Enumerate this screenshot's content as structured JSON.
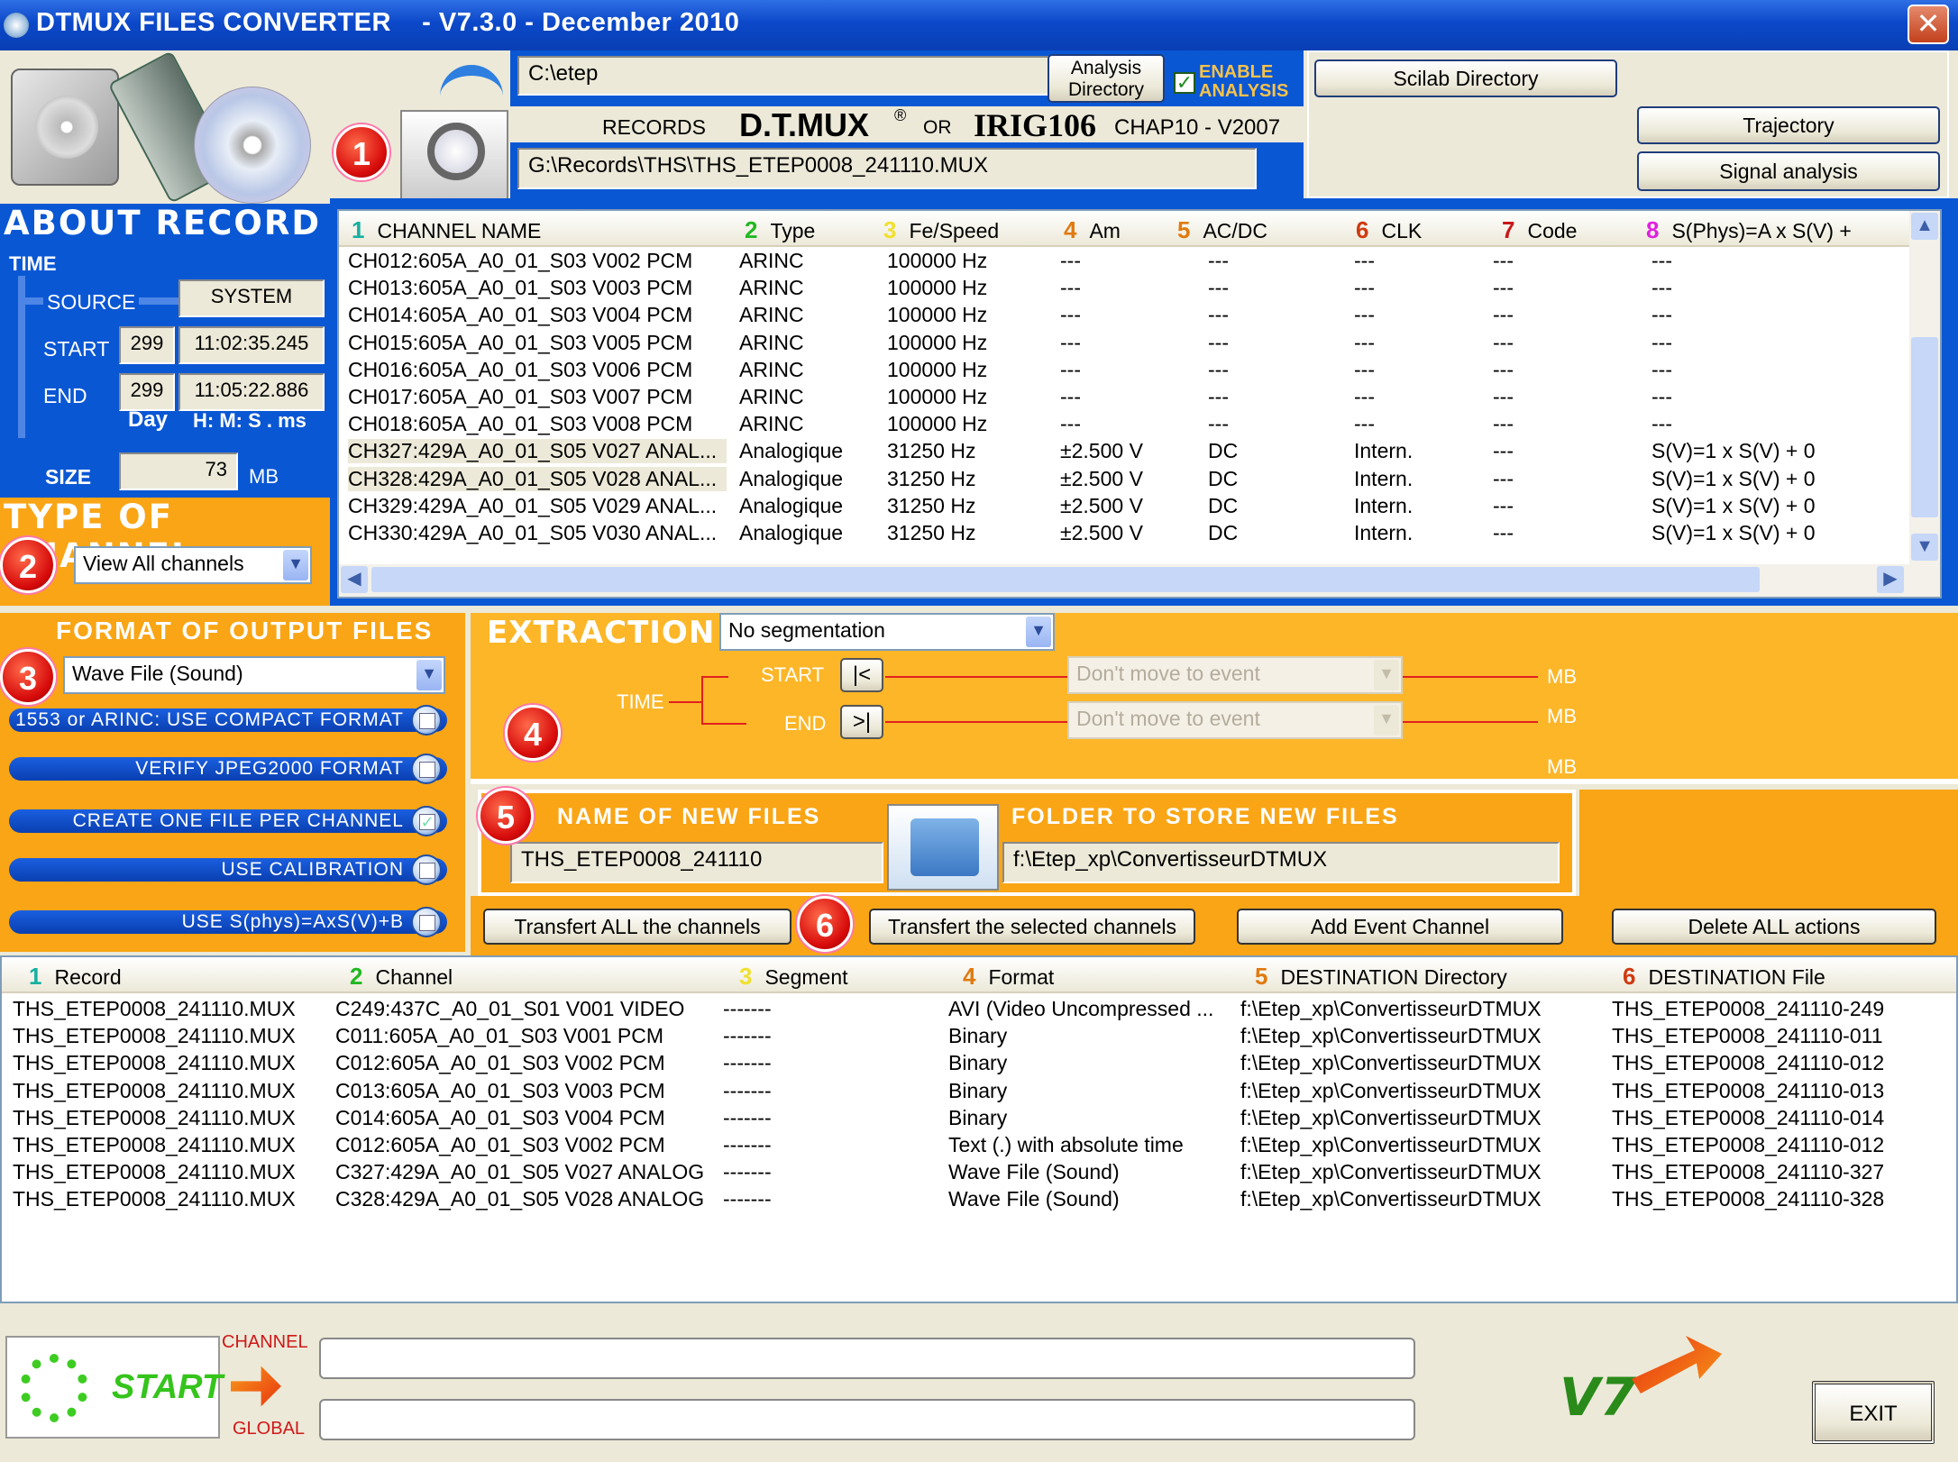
{
  "window": {
    "title": "DTMUX FILES CONVERTER    - V7.3.0 - December 2010"
  },
  "top": {
    "analysis_path": "C:\\etep",
    "analysis_dir_label": "Analysis Directory",
    "enable_analysis": "ENABLE ANALYSIS",
    "records_label": "RECORDS",
    "dtmux_label": "D.T.MUX",
    "reg_mark": "®",
    "or_label": "OR",
    "irig_label": "IRIG106",
    "chap_label": "CHAP10 - V2007",
    "record_path": "G:\\Records\\THS\\THS_ETEP0008_241110.MUX",
    "scilab_btn": "Scilab Directory",
    "trajectory_btn": "Trajectory",
    "signal_btn": "Signal analysis"
  },
  "about": {
    "title": "ABOUT  RECORD",
    "time_label": "TIME",
    "source_label": "SOURCE",
    "source_value": "SYSTEM",
    "start_label": "START",
    "start_day": "299",
    "start_time": "11:02:35.245",
    "end_label": "END",
    "end_day": "299",
    "end_time": "11:05:22.886",
    "day_label": "Day",
    "hms_label": "H: M: S . ms",
    "size_label": "SIZE",
    "size_value": "73",
    "size_unit": "MB"
  },
  "type_of_channel": {
    "title": "TYPE  OF  CHANNEL",
    "selected": "View All channels"
  },
  "badges": {
    "b1": "1",
    "b2": "2",
    "b3": "3",
    "b4": "4",
    "b5": "5",
    "b6": "6"
  },
  "channel_table": {
    "headers": [
      {
        "n": "1",
        "label": "CHANNEL NAME",
        "color": "#17b0a0"
      },
      {
        "n": "2",
        "label": "Type",
        "color": "#22b822"
      },
      {
        "n": "3",
        "label": "Fe/Speed",
        "color": "#f0e030"
      },
      {
        "n": "4",
        "label": "Am",
        "color": "#e07a10"
      },
      {
        "n": "5",
        "label": "AC/DC",
        "color": "#e07a10"
      },
      {
        "n": "6",
        "label": "CLK",
        "color": "#d03a10"
      },
      {
        "n": "7",
        "label": "Code",
        "color": "#c81818"
      },
      {
        "n": "8",
        "label": "S(Phys)=A x S(V) +",
        "color": "#e020e0"
      }
    ],
    "rows": [
      [
        "CH012:605A_A0_01_S03 V002 PCM",
        "ARINC",
        "100000 Hz",
        "---",
        "---",
        "---",
        "---",
        "---"
      ],
      [
        "CH013:605A_A0_01_S03 V003 PCM",
        "ARINC",
        "100000 Hz",
        "---",
        "---",
        "---",
        "---",
        "---"
      ],
      [
        "CH014:605A_A0_01_S03 V004 PCM",
        "ARINC",
        "100000 Hz",
        "---",
        "---",
        "---",
        "---",
        "---"
      ],
      [
        "CH015:605A_A0_01_S03 V005 PCM",
        "ARINC",
        "100000 Hz",
        "---",
        "---",
        "---",
        "---",
        "---"
      ],
      [
        "CH016:605A_A0_01_S03 V006 PCM",
        "ARINC",
        "100000 Hz",
        "---",
        "---",
        "---",
        "---",
        "---"
      ],
      [
        "CH017:605A_A0_01_S03 V007 PCM",
        "ARINC",
        "100000 Hz",
        "---",
        "---",
        "---",
        "---",
        "---"
      ],
      [
        "CH018:605A_A0_01_S03 V008 PCM",
        "ARINC",
        "100000 Hz",
        "---",
        "---",
        "---",
        "---",
        "---"
      ],
      [
        "CH327:429A_A0_01_S05 V027 ANAL...",
        "Analogique",
        "31250 Hz",
        "±2.500 V",
        "DC",
        "Intern.",
        "---",
        "S(V)=1 x S(V) + 0"
      ],
      [
        "CH328:429A_A0_01_S05 V028 ANAL...",
        "Analogique",
        "31250 Hz",
        "±2.500 V",
        "DC",
        "Intern.",
        "---",
        "S(V)=1 x S(V) + 0"
      ],
      [
        "CH329:429A_A0_01_S05 V029 ANAL...",
        "Analogique",
        "31250 Hz",
        "±2.500 V",
        "DC",
        "Intern.",
        "---",
        "S(V)=1 x S(V) + 0"
      ],
      [
        "CH330:429A_A0_01_S05 V030 ANAL...",
        "Analogique",
        "31250 Hz",
        "±2.500 V",
        "DC",
        "Intern.",
        "---",
        "S(V)=1 x S(V) + 0"
      ]
    ]
  },
  "format": {
    "title": "FORMAT  OF  OUTPUT  FILES",
    "selected": "Wave File (Sound)",
    "opt1": "1553 or ARINC: USE COMPACT FORMAT",
    "opt2": "VERIFY  JPEG2000  FORMAT",
    "opt3": "CREATE  ONE  FILE  PER  CHANNEL",
    "opt4": "USE  CALIBRATION",
    "opt5": "USE   S(phys)=AxS(V)+B",
    "opt3_checked": true
  },
  "extraction": {
    "title": "EXTRACTION",
    "segmentation": "No segmentation",
    "time_label": "TIME",
    "start_label": "START",
    "end_label": "END",
    "start_btn": "|<",
    "end_btn": ">|",
    "start_event": "Don't move to event",
    "end_event": "Don't move to event",
    "mb1": "MB",
    "mb2": "MB",
    "mb3": "MB"
  },
  "newfiles": {
    "name_title": "NAME  OF  NEW  FILES",
    "folder_title": "FOLDER  TO  STORE  NEW  FILES",
    "name_value": "THS_ETEP0008_241110",
    "folder_value": "f:\\Etep_xp\\ConvertisseurDTMUX"
  },
  "actions": {
    "transfer_all": "Transfert ALL the channels",
    "transfer_selected": "Transfert the selected channels",
    "add_event": "Add Event Channel",
    "delete_all": "Delete ALL actions"
  },
  "action_table": {
    "headers": [
      {
        "n": "1",
        "label": "Record",
        "color": "#17b0a0"
      },
      {
        "n": "2",
        "label": "Channel",
        "color": "#22b822"
      },
      {
        "n": "3",
        "label": "Segment",
        "color": "#f0e030"
      },
      {
        "n": "4",
        "label": "Format",
        "color": "#e07a10"
      },
      {
        "n": "5",
        "label": "DESTINATION Directory",
        "color": "#e07a10"
      },
      {
        "n": "6",
        "label": "DESTINATION File",
        "color": "#d03a10"
      }
    ],
    "rows": [
      [
        "THS_ETEP0008_241110.MUX",
        "C249:437C_A0_01_S01 V001 VIDEO",
        "-------",
        "AVI (Video Uncompressed ...",
        "f:\\Etep_xp\\ConvertisseurDTMUX",
        "THS_ETEP0008_241110-249"
      ],
      [
        "THS_ETEP0008_241110.MUX",
        "C011:605A_A0_01_S03 V001 PCM",
        "-------",
        "Binary",
        "f:\\Etep_xp\\ConvertisseurDTMUX",
        "THS_ETEP0008_241110-011"
      ],
      [
        "THS_ETEP0008_241110.MUX",
        "C012:605A_A0_01_S03 V002 PCM",
        "-------",
        "Binary",
        "f:\\Etep_xp\\ConvertisseurDTMUX",
        "THS_ETEP0008_241110-012"
      ],
      [
        "THS_ETEP0008_241110.MUX",
        "C013:605A_A0_01_S03 V003 PCM",
        "-------",
        "Binary",
        "f:\\Etep_xp\\ConvertisseurDTMUX",
        "THS_ETEP0008_241110-013"
      ],
      [
        "THS_ETEP0008_241110.MUX",
        "C014:605A_A0_01_S03 V004 PCM",
        "-------",
        "Binary",
        "f:\\Etep_xp\\ConvertisseurDTMUX",
        "THS_ETEP0008_241110-014"
      ],
      [
        "THS_ETEP0008_241110.MUX",
        "C012:605A_A0_01_S03 V002 PCM",
        "-------",
        "Text (.) with absolute time",
        "f:\\Etep_xp\\ConvertisseurDTMUX",
        "THS_ETEP0008_241110-012"
      ],
      [
        "THS_ETEP0008_241110.MUX",
        "C327:429A_A0_01_S05 V027 ANALOG",
        "-------",
        "Wave File (Sound)",
        "f:\\Etep_xp\\ConvertisseurDTMUX",
        "THS_ETEP0008_241110-327"
      ],
      [
        "THS_ETEP0008_241110.MUX",
        "C328:429A_A0_01_S05 V028 ANALOG",
        "-------",
        "Wave File (Sound)",
        "f:\\Etep_xp\\ConvertisseurDTMUX",
        "THS_ETEP0008_241110-328"
      ]
    ]
  },
  "bottom": {
    "start_btn": "START",
    "channel_label": "CHANNEL",
    "global_label": "GLOBAL",
    "channel_progress": 0,
    "global_progress": 0,
    "logo_text": "V7",
    "exit_btn": "EXIT"
  },
  "colors": {
    "panel_blue": "#0a57d4",
    "panel_orange": "#f9a515",
    "badge_red": "#d70b0b"
  }
}
